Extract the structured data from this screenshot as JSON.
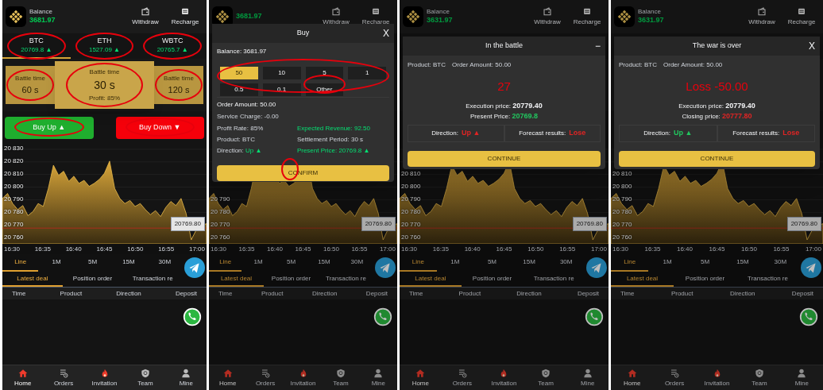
{
  "panels": [
    {
      "header": {
        "balance_label": "Balance",
        "balance": "3681.97",
        "actions": [
          {
            "kind": "withdraw",
            "label": "Withdraw"
          },
          {
            "kind": "recharge",
            "label": "Recharge"
          }
        ]
      },
      "coins": [
        {
          "name": "BTC",
          "price": "20769.8 ▲",
          "selected": true,
          "circled": true
        },
        {
          "name": "ETH",
          "price": "1527.09 ▲",
          "selected": false,
          "circled": true
        },
        {
          "name": "WBTC",
          "price": "20765.7 ▲",
          "selected": false,
          "circled": true
        }
      ],
      "durations": [
        {
          "label": "Battle time",
          "value": "60 s",
          "selected": false,
          "circled": true
        },
        {
          "label": "Battle time",
          "value": "30 s",
          "profit": "Profit: 85%",
          "selected": true,
          "circled": true
        },
        {
          "label": "Battle time",
          "value": "120 s",
          "selected": false,
          "circled": true
        }
      ],
      "trade_buttons": [
        {
          "kind": "up",
          "label": "Buy Up ▲",
          "circled": true
        },
        {
          "kind": "down",
          "label": "Buy Down ▼",
          "circled": true
        }
      ],
      "chart": {
        "y_labels": [
          "20 830",
          "20 820",
          "20 810",
          "20 800",
          "20 790",
          "20 780",
          "20 770",
          "20 760"
        ],
        "x_labels": [
          "16:30",
          "16:35",
          "16:40",
          "16:45",
          "16:50",
          "16:55",
          "17:00"
        ],
        "price_tag": "20769.80"
      },
      "intervals": [
        {
          "label": "Line",
          "selected": true
        },
        {
          "label": "1M",
          "selected": false
        },
        {
          "label": "5M",
          "selected": false
        },
        {
          "label": "15M",
          "selected": false
        },
        {
          "label": "30M",
          "selected": false
        }
      ],
      "deal_tabs": [
        {
          "label": "Latest deal",
          "selected": true
        },
        {
          "label": "Position order",
          "selected": false
        },
        {
          "label": "Transaction re",
          "selected": false
        }
      ],
      "columns": [
        "Time",
        "Product",
        "Direction",
        "Deposit"
      ],
      "nav": [
        {
          "kind": "home",
          "label": "Home",
          "selected": true
        },
        {
          "kind": "orders",
          "label": "Orders",
          "selected": false
        },
        {
          "kind": "invitation",
          "label": "Invitation",
          "selected": false
        },
        {
          "kind": "team",
          "label": "Team",
          "selected": false
        },
        {
          "kind": "mine",
          "label": "Mine",
          "selected": false
        }
      ]
    },
    {
      "header": {
        "balance": "3681.97",
        "actions": [
          {
            "kind": "withdraw",
            "label": "Withdraw"
          },
          {
            "kind": "recharge",
            "label": "Recharge"
          }
        ]
      },
      "chart": {
        "y_labels": [
          "20 790",
          "20 780",
          "20 770",
          "20 760"
        ],
        "x_labels": [
          "16:30",
          "16:35",
          "16:40",
          "16:45",
          "16:50",
          "16:55",
          "17:00"
        ],
        "price_tag": "20769.80"
      },
      "intervals": [
        {
          "label": "Line",
          "selected": true
        },
        {
          "label": "1M",
          "selected": false
        },
        {
          "label": "5M",
          "selected": false
        },
        {
          "label": "15M",
          "selected": false
        },
        {
          "label": "30M",
          "selected": false
        }
      ],
      "deal_tabs": [
        {
          "label": "Latest deal",
          "selected": true
        },
        {
          "label": "Position order",
          "selected": false
        },
        {
          "label": "Transaction re",
          "selected": false
        }
      ],
      "columns": [
        "Time",
        "Product",
        "Direction",
        "Deposit"
      ],
      "nav": [
        {
          "kind": "home",
          "label": "Home",
          "selected": true
        },
        {
          "kind": "orders",
          "label": "Orders",
          "selected": false
        },
        {
          "kind": "invitation",
          "label": "Invitation",
          "selected": false
        },
        {
          "kind": "team",
          "label": "Team",
          "selected": false
        },
        {
          "kind": "mine",
          "label": "Mine",
          "selected": false
        }
      ],
      "modal": {
        "kind": "buy",
        "title": "Buy",
        "control": "X",
        "balance": "Balance: 3681.97",
        "amounts_circled": true,
        "amounts": [
          {
            "label": "50",
            "selected": true,
            "circled": false
          },
          {
            "label": "10",
            "selected": false,
            "circled": false
          },
          {
            "label": "5",
            "selected": false,
            "circled": false
          },
          {
            "label": "1",
            "selected": false,
            "circled": false
          },
          {
            "label": "0.5",
            "selected": false,
            "circled": false
          },
          {
            "label": "0.1",
            "selected": false,
            "circled": false
          },
          {
            "label": "Other",
            "selected": false,
            "circled": true
          }
        ],
        "order_amount": "Order Amount: 50.00",
        "service_charge": "Service Charge: -0.00",
        "details": [
          {
            "label": "Profit Rate:",
            "value": "85%",
            "label_green": false,
            "value_green": false
          },
          {
            "label": "Expected Revenue:",
            "value": "92.50",
            "label_green": true,
            "value_green": true
          },
          {
            "label": "Product:",
            "value": "BTC",
            "label_green": false,
            "value_green": false
          },
          {
            "label": "Settlement Period:",
            "value": "30 s",
            "label_green": false,
            "value_green": false
          },
          {
            "label": "Direction:",
            "value": "Up ▲",
            "label_green": false,
            "value_green": true
          },
          {
            "label": "Present Price:",
            "value": "20769.8 ▲",
            "label_green": true,
            "value_green": true
          }
        ],
        "button": {
          "label": "CONFIRM",
          "circled": true
        }
      }
    },
    {
      "header": {
        "balance_label": "Balance",
        "balance": "3631.97",
        "actions": [
          {
            "kind": "withdraw",
            "label": "Withdraw"
          },
          {
            "kind": "recharge",
            "label": "Recharge"
          }
        ]
      },
      "chart": {
        "y_labels": [
          "20 810",
          "20 800",
          "20 790",
          "20 780",
          "20 770",
          "20 760"
        ],
        "x_labels": [
          "16:30",
          "16:35",
          "16:40",
          "16:45",
          "16:50",
          "16:55",
          "17:00"
        ],
        "price_tag": "20769.80"
      },
      "intervals": [
        {
          "label": "Line",
          "selected": true
        },
        {
          "label": "1M",
          "selected": false
        },
        {
          "label": "5M",
          "selected": false
        },
        {
          "label": "15M",
          "selected": false
        },
        {
          "label": "30M",
          "selected": false
        }
      ],
      "deal_tabs": [
        {
          "label": "Latest deal",
          "selected": true
        },
        {
          "label": "Position order",
          "selected": false
        },
        {
          "label": "Transaction re",
          "selected": false
        }
      ],
      "columns": [
        "Time",
        "Product",
        "Direction",
        "Deposit"
      ],
      "nav": [
        {
          "kind": "home",
          "label": "Home",
          "selected": true
        },
        {
          "kind": "orders",
          "label": "Orders",
          "selected": false
        },
        {
          "kind": "invitation",
          "label": "Invitation",
          "selected": false
        },
        {
          "kind": "team",
          "label": "Team",
          "selected": false
        },
        {
          "kind": "mine",
          "label": "Mine",
          "selected": false
        }
      ],
      "modal": {
        "kind": "status",
        "title": "In the battle",
        "control": "−",
        "product": "Product: BTC",
        "order_amount": "Order Amount: 50.00",
        "headline": "27",
        "lines": [
          {
            "label": "Execution price:",
            "value": "20779.40"
          },
          {
            "label": "Present Price:",
            "value": "20769.8",
            "color": "#22c55e"
          }
        ],
        "outcome": [
          {
            "label": "Direction:",
            "value": "Up ▲",
            "color": "#e02424"
          },
          {
            "label": "Forecast results:",
            "value": "Lose",
            "color": "#e02424"
          }
        ],
        "button": {
          "label": "CONTINUE"
        }
      }
    },
    {
      "header": {
        "balance_label": "Balance",
        "balance": "3631.97",
        "actions": [
          {
            "kind": "withdraw",
            "label": "Withdraw"
          },
          {
            "kind": "recharge",
            "label": "Recharge"
          }
        ]
      },
      "chart": {
        "y_labels": [
          "20 810",
          "20 800",
          "20 790",
          "20 780",
          "20 770",
          "20 760"
        ],
        "x_labels": [
          "16:30",
          "16:35",
          "16:40",
          "16:45",
          "16:50",
          "16:55",
          "17:00"
        ],
        "price_tag": "20769.80"
      },
      "intervals": [
        {
          "label": "Line",
          "selected": true
        },
        {
          "label": "1M",
          "selected": false
        },
        {
          "label": "5M",
          "selected": false
        },
        {
          "label": "15M",
          "selected": false
        },
        {
          "label": "30M",
          "selected": false
        }
      ],
      "deal_tabs": [
        {
          "label": "Latest deal",
          "selected": true
        },
        {
          "label": "Position order",
          "selected": false
        },
        {
          "label": "Transaction re",
          "selected": false
        }
      ],
      "columns": [
        "Time",
        "Product",
        "Direction",
        "Deposit"
      ],
      "nav": [
        {
          "kind": "home",
          "label": "Home",
          "selected": true
        },
        {
          "kind": "orders",
          "label": "Orders",
          "selected": false
        },
        {
          "kind": "invitation",
          "label": "Invitation",
          "selected": false
        },
        {
          "kind": "team",
          "label": "Team",
          "selected": false
        },
        {
          "kind": "mine",
          "label": "Mine",
          "selected": false
        }
      ],
      "modal": {
        "kind": "status",
        "title": "The war is over",
        "control": "X",
        "product": "Product: BTC",
        "order_amount": "Order Amount: 50.00",
        "headline": "Loss -50.00",
        "lines": [
          {
            "label": "Execution price:",
            "value": "20779.40"
          },
          {
            "label": "Closing price:",
            "value": "20777.80",
            "color": "#e02424"
          }
        ],
        "outcome": [
          {
            "label": "Direction:",
            "value": "Up ▲",
            "color": "#22c55e"
          },
          {
            "label": "Forecast results:",
            "value": "Lose",
            "color": "#e02424"
          }
        ],
        "button": {
          "label": "CONTINUE"
        }
      }
    }
  ]
}
